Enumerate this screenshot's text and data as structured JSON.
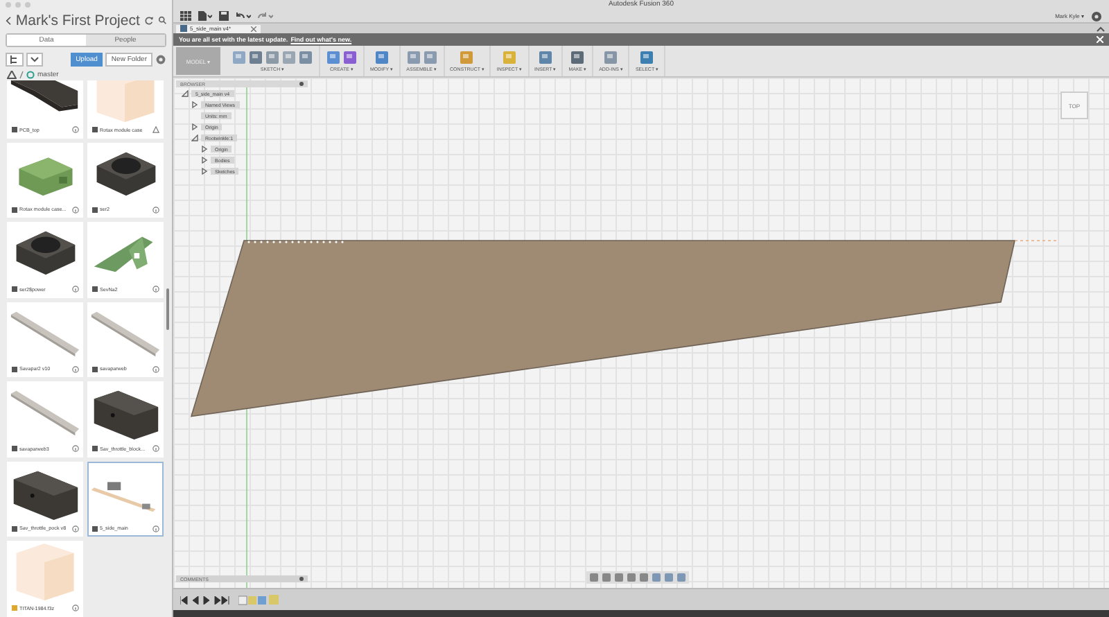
{
  "panel": {
    "project_title": "Mark's First Project",
    "tabs": [
      {
        "label": "Data",
        "selected": true
      },
      {
        "label": "People",
        "selected": false
      }
    ],
    "upload_button": "Upload",
    "new_folder_button": "New Folder",
    "breadcrumb": "master",
    "files": [
      {
        "name": "PCB_top",
        "thumbnail": {
          "kind": "dark"
        },
        "badge": {
          "kind": "info"
        },
        "selected": false
      },
      {
        "name": "Rotax module case",
        "thumbnail": {
          "kind": "empty"
        },
        "badge": {
          "kind": "upload"
        },
        "selected": false
      },
      {
        "name": "Rotax module case...",
        "thumbnail": {
          "kind": "green"
        },
        "badge": {
          "kind": "info"
        },
        "selected": false
      },
      {
        "name": "ser2",
        "thumbnail": {
          "kind": "ring"
        },
        "badge": {
          "kind": "info"
        },
        "selected": false
      },
      {
        "name": "ser2$power",
        "thumbnail": {
          "kind": "ring"
        },
        "badge": {
          "kind": "info"
        },
        "selected": false
      },
      {
        "name": "SevNa2",
        "thumbnail": {
          "kind": "bracket"
        },
        "badge": {
          "kind": "info"
        },
        "selected": false
      },
      {
        "name": "Savapar2 v10",
        "thumbnail": {
          "kind": "bar"
        },
        "badge": {
          "kind": "info"
        },
        "selected": false
      },
      {
        "name": "savaparweb",
        "thumbnail": {
          "kind": "bar"
        },
        "badge": {
          "kind": "info"
        },
        "selected": false
      },
      {
        "name": "savaparweb3",
        "thumbnail": {
          "kind": "bar"
        },
        "badge": {
          "kind": "info"
        },
        "selected": false
      },
      {
        "name": "Sav_throttle_block...",
        "thumbnail": {
          "kind": "block"
        },
        "badge": {
          "kind": "info"
        },
        "selected": false
      },
      {
        "name": "Sav_throttle_pock v8",
        "thumbnail": {
          "kind": "block"
        },
        "badge": {
          "kind": "info"
        },
        "selected": false
      },
      {
        "name": "5_side_main",
        "thumbnail": {
          "kind": "assembly"
        },
        "badge": {
          "kind": "info"
        },
        "selected": true
      },
      {
        "name": "TITAN-1984.f3z",
        "thumbnail": {
          "kind": "empty"
        },
        "badge": {
          "kind": "info"
        },
        "selected": false
      }
    ]
  },
  "window": {
    "title": "Autodesk Fusion 360",
    "user": "Mark Kyle ▾"
  },
  "doc_tab": {
    "label": "5_side_main v4*"
  },
  "banner": {
    "text": "You are all set with the latest update.",
    "link": "Find out what's new."
  },
  "ribbon": {
    "workspace": "MODEL ▾",
    "groups": [
      {
        "label": "SKETCH ▾"
      },
      {
        "label": "CREATE ▾"
      },
      {
        "label": "MODIFY ▾"
      },
      {
        "label": "ASSEMBLE ▾"
      },
      {
        "label": "CONSTRUCT ▾"
      },
      {
        "label": "INSPECT ▾"
      },
      {
        "label": "INSERT ▾"
      },
      {
        "label": "MAKE ▾"
      },
      {
        "label": "ADD-INS ▾"
      },
      {
        "label": "SELECT ▾"
      }
    ]
  },
  "browser": {
    "title": "BROWSER",
    "tree": [
      {
        "label": "5_side_main v4",
        "expanded": true,
        "children": [
          {
            "label": "Named Views",
            "expanded": false
          },
          {
            "label": "Units: mm"
          },
          {
            "label": "Origin",
            "expanded": false
          },
          {
            "label": "Rootwinkle:1",
            "expanded": true,
            "children": [
              {
                "label": "Origin",
                "expanded": false
              },
              {
                "label": "Bodies",
                "expanded": false
              },
              {
                "label": "Sketches",
                "expanded": false
              }
            ]
          }
        ]
      }
    ]
  },
  "viewcube": {
    "label": "TOP"
  },
  "comments": {
    "title": "COMMENTS"
  }
}
